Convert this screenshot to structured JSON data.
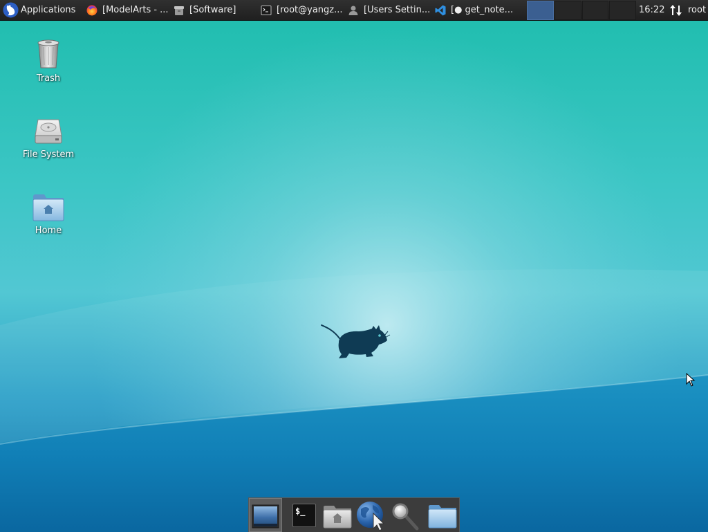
{
  "panel": {
    "applications": {
      "icon": "xfce-logo-icon",
      "label": "Applications"
    },
    "tasks": [
      {
        "icon": "firefox-icon",
        "label": "[ModelArts - ..."
      },
      {
        "icon": "software-package-icon",
        "label": "[Software]"
      },
      {
        "icon": "terminal-icon",
        "label": "[root@yangz..."
      },
      {
        "icon": "user-icon",
        "label": "[Users Settin..."
      },
      {
        "icon": "vscode-icon",
        "label": "[● get_note..."
      }
    ],
    "workspaces": [
      {
        "active": true
      },
      {
        "active": false
      },
      {
        "active": false
      },
      {
        "active": false
      }
    ],
    "clock": "16:22",
    "network_icon": "network-transfer-icon",
    "user": "root"
  },
  "desktop": {
    "icons": [
      {
        "icon": "trash-icon",
        "label": "Trash"
      },
      {
        "icon": "hard-drive-icon",
        "label": "File System"
      },
      {
        "icon": "home-folder-icon",
        "label": "Home"
      }
    ],
    "logo_icon": "xfce-mouse-logo-icon"
  },
  "dock": {
    "items": [
      {
        "icon": "show-desktop-icon",
        "active": true
      },
      {
        "icon": "terminal-icon",
        "glyph": "$_",
        "active": false
      },
      {
        "icon": "home-folder-icon",
        "active": false
      },
      {
        "icon": "web-browser-icon",
        "active": false
      },
      {
        "icon": "search-icon",
        "active": false
      },
      {
        "icon": "folder-icon",
        "active": false
      }
    ]
  },
  "colors": {
    "panel_bg": "#252525",
    "panel_text": "#eeeeee",
    "active_workspace": "#3b5f91",
    "dock_bg": "#3c3c3c",
    "wallpaper_top": "#1ebdad",
    "wallpaper_bottom": "#0a6aa3",
    "logo_color": "#0f3b54"
  }
}
